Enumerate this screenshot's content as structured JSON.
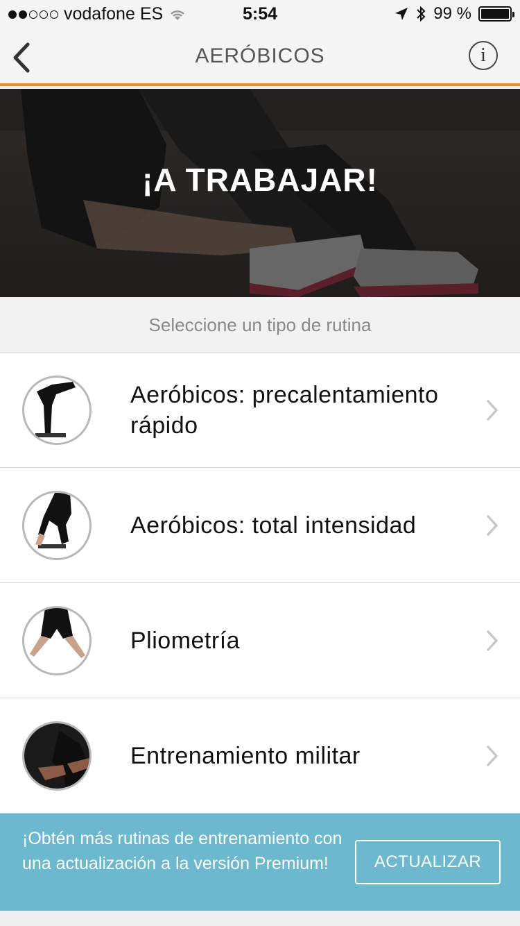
{
  "status_bar": {
    "carrier": "vodafone ES",
    "time": "5:54",
    "battery": "99 %",
    "battery_level": 0.99
  },
  "nav": {
    "title": "AERÓBICOS",
    "info_glyph": "i"
  },
  "hero": {
    "title": "¡A TRABAJAR!"
  },
  "subheader": "Seleccione un tipo de rutina",
  "routines": [
    {
      "label": "Aeróbicos: precalentamiento rápido",
      "icon": "stretch-figure"
    },
    {
      "label": "Aeróbicos: total intensidad",
      "icon": "lunge-figure"
    },
    {
      "label": "Pliometría",
      "icon": "jump-figure"
    },
    {
      "label": "Entrenamiento militar",
      "icon": "pushup-figure"
    }
  ],
  "promo": {
    "text": "¡Obtén más rutinas de entrenamiento con una actualización a la versión Premium!",
    "button_label": "ACTUALIZAR"
  },
  "colors": {
    "accent": "#f58a1f",
    "promo_bg": "#6bb8cf"
  }
}
